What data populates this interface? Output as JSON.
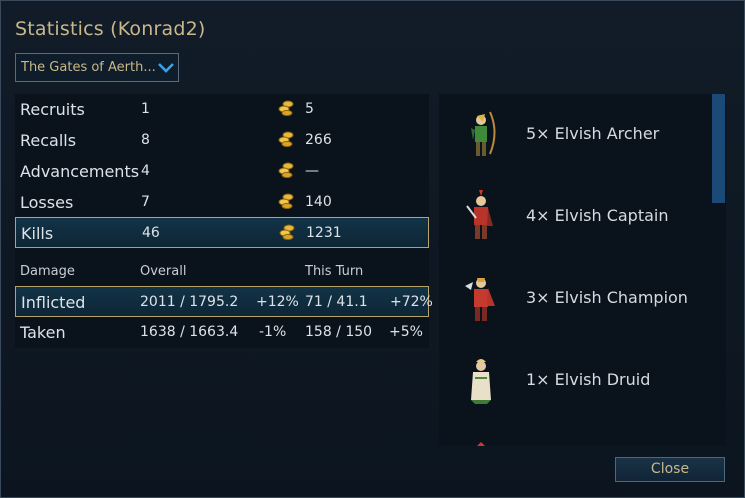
{
  "title": "Statistics (Konrad2)",
  "scenario_select": {
    "value": "The Gates of Aerth..."
  },
  "stats_rows": [
    {
      "label": "Recruits",
      "count": "1",
      "gold": "5"
    },
    {
      "label": "Recalls",
      "count": "8",
      "gold": "266"
    },
    {
      "label": "Advancements",
      "count": "4",
      "gold": "—"
    },
    {
      "label": "Losses",
      "count": "7",
      "gold": "140"
    },
    {
      "label": "Kills",
      "count": "46",
      "gold": "1231"
    }
  ],
  "damage": {
    "headers": {
      "damage": "Damage",
      "overall": "Overall",
      "this_turn": "This Turn"
    },
    "rows": [
      {
        "label": "Inflicted",
        "overall": "2011 / 1795.2",
        "overall_pct": "+12%",
        "turn": "71 / 41.1",
        "turn_pct": "+72%"
      },
      {
        "label": "Taken",
        "overall": "1638 / 1663.4",
        "overall_pct": "-1%",
        "turn": "158 / 150",
        "turn_pct": "+5%"
      }
    ]
  },
  "units": [
    {
      "label": "5× Elvish Archer",
      "icon": "elvish-archer-sprite"
    },
    {
      "label": "4× Elvish Captain",
      "icon": "elvish-captain-sprite"
    },
    {
      "label": "3× Elvish Champion",
      "icon": "elvish-champion-sprite"
    },
    {
      "label": "1× Elvish Druid",
      "icon": "elvish-druid-sprite"
    }
  ],
  "scrollbar": {
    "position": 0.0
  },
  "close_label": "Close",
  "colors": {
    "gold_text": "#c8b88a",
    "highlight_border": "#b8a268",
    "scroll_thumb": "#1c4a78"
  }
}
